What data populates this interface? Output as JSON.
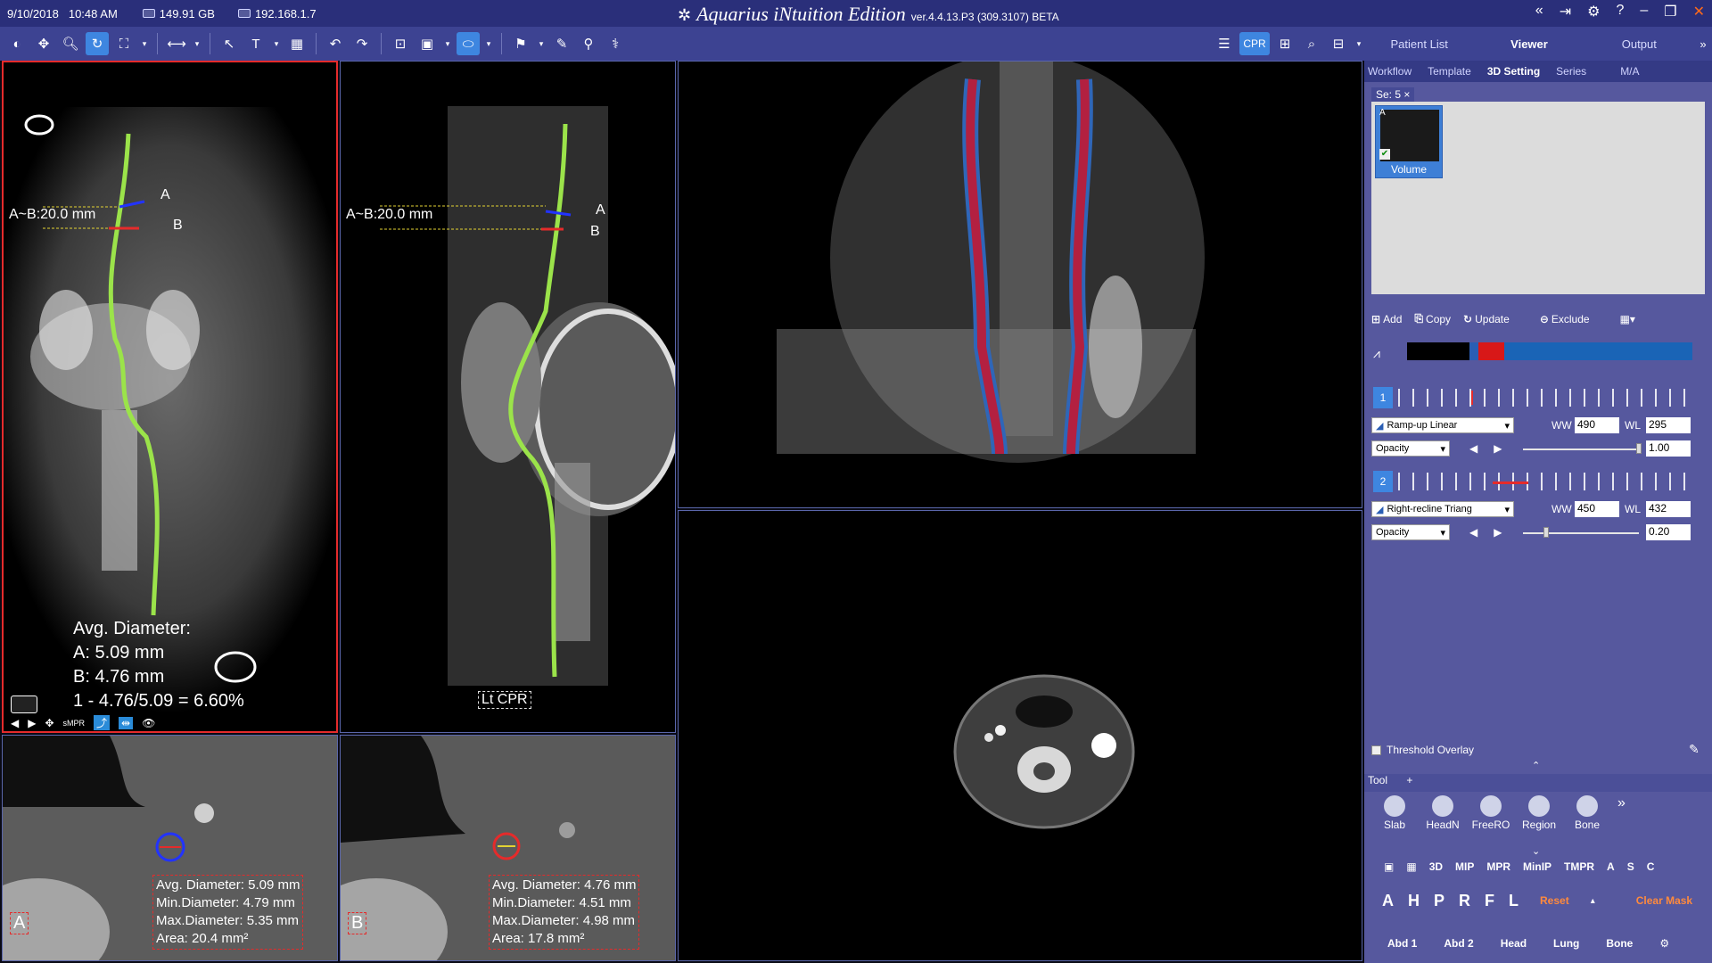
{
  "titlebar": {
    "date": "9/10/2018",
    "time": "10:48 AM",
    "disk": "149.91 GB",
    "ip": "192.168.1.7",
    "app_name": "Aquarius iNtuition Edition",
    "version": "ver.4.4.13.P3 (309.3107) BETA"
  },
  "toolbar": {
    "cpr_label": "CPR"
  },
  "right_tabs": [
    "Patient List",
    "Viewer",
    "Output"
  ],
  "sub_tabs": [
    "Workflow",
    "Template",
    "3D Setting",
    "Series",
    "M/A"
  ],
  "viewport1": {
    "measurement": "A~B:20.0 mm",
    "label_a": "A",
    "label_b": "B",
    "avg_title": "Avg. Diameter:",
    "avg_a": "A: 5.09 mm",
    "avg_b": "B: 4.76 mm",
    "ratio": "1 - 4.76/5.09 = 6.60%",
    "tool_smpr": "sMPR"
  },
  "viewport2": {
    "measurement": "A~B:20.0 mm",
    "label_a": "A",
    "label_b": "B",
    "cpr_label": "Lt CPR"
  },
  "viewport5": {
    "corner": "A",
    "avg": "Avg. Diameter: 5.09 mm",
    "min": "Min.Diameter: 4.79 mm",
    "max": "Max.Diameter: 5.35 mm",
    "area": "Area: 20.4 mm²"
  },
  "viewport6": {
    "corner": "B",
    "avg": "Avg. Diameter: 4.76 mm",
    "min": "Min.Diameter: 4.51 mm",
    "max": "Max.Diameter: 4.98 mm",
    "area": "Area: 17.8 mm²"
  },
  "panel": {
    "series_tab": "Se: 5",
    "thumb_corner": "A",
    "thumb_label": "Volume",
    "add": "Add",
    "copy": "Copy",
    "update": "Update",
    "exclude": "Exclude",
    "tf1": {
      "index": "1",
      "curve": "Ramp-up Linear",
      "ww_label": "WW",
      "ww": "490",
      "wl_label": "WL",
      "wl": "295",
      "mode": "Opacity",
      "opacity": "1.00",
      "opacity_value": 1.0
    },
    "tf2": {
      "index": "2",
      "curve": "Right-recline Triang",
      "ww_label": "WW",
      "ww": "450",
      "wl_label": "WL",
      "wl": "432",
      "mode": "Opacity",
      "opacity": "0.20",
      "opacity_value": 0.2
    },
    "threshold": "Threshold Overlay",
    "tool_header": "Tool",
    "tools": [
      "Slab",
      "HeadN",
      "FreeRO",
      "Region",
      "Bone"
    ],
    "modes": [
      "3D",
      "MIP",
      "MPR",
      "MinIP",
      "TMPR",
      "A",
      "S",
      "C"
    ],
    "orients": [
      "A",
      "H",
      "P",
      "R",
      "F",
      "L"
    ],
    "reset": "Reset",
    "clear_mask": "Clear Mask",
    "presets": [
      "Abd 1",
      "Abd 2",
      "Head",
      "Lung",
      "Bone"
    ]
  },
  "colors": {
    "title_bg": "#2a2f7a",
    "toolbar_bg": "#3d4392",
    "panel_bg": "#56589e",
    "active_blue": "#3e86e0",
    "active_border": "#e52b2b",
    "centerline": "#9be34a"
  }
}
